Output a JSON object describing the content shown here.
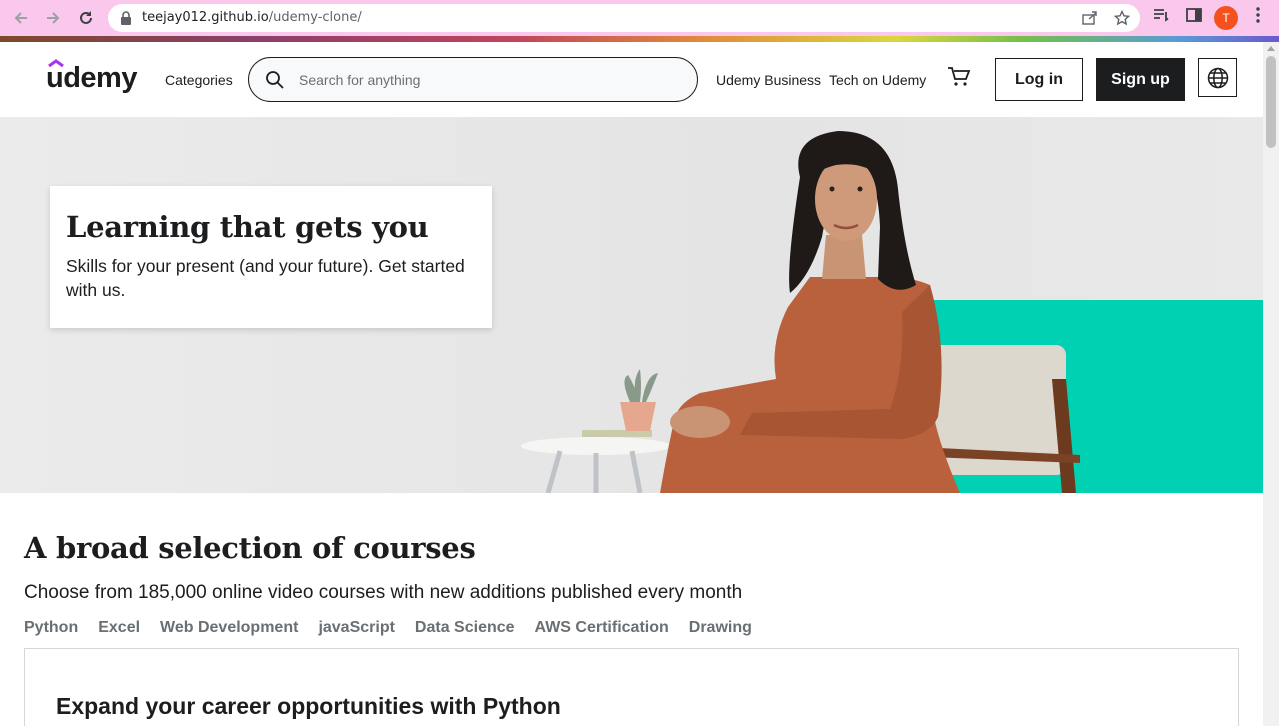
{
  "browser": {
    "url_host": "teejay012.github.io",
    "url_path": "/udemy-clone/",
    "profile_initial": "T"
  },
  "header": {
    "logo_text": "udemy",
    "categories": "Categories",
    "search_placeholder": "Search for anything",
    "business_link": "Udemy Business",
    "tech_link": "Tech on Udemy",
    "login": "Log in",
    "signup": "Sign up"
  },
  "hero": {
    "title": "Learning that gets you",
    "subtitle": "Skills for your present (and your future). Get started with us."
  },
  "courses": {
    "title": "A broad selection of courses",
    "subtitle": "Choose from 185,000 online video courses with new additions published every month",
    "tabs": [
      "Python",
      "Excel",
      "Web Development",
      "javaScript",
      "Data Science",
      "AWS Certification",
      "Drawing"
    ],
    "panel_title": "Expand your career opportunities with Python"
  },
  "colors": {
    "brand_purple": "#a435f0",
    "dark": "#1c1d1f",
    "hero_bg": "#ebebeb",
    "teal": "#00d1b2",
    "tab_grey": "#6a6f73"
  },
  "icons": [
    "back-arrow-icon",
    "forward-arrow-icon",
    "reload-icon",
    "lock-icon",
    "share-icon",
    "star-icon",
    "reading-list-icon",
    "side-panel-icon",
    "menu-dots-icon",
    "search-icon",
    "cart-icon",
    "globe-icon"
  ]
}
